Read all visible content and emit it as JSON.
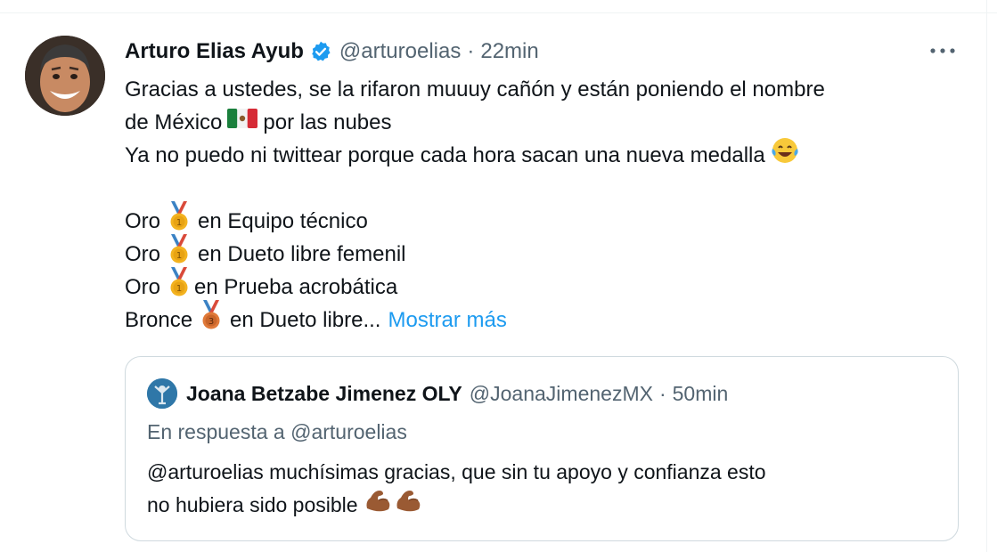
{
  "tweet": {
    "author_name": "Arturo Elias Ayub",
    "handle": "@arturoelias",
    "separator": "·",
    "time": "22min",
    "more_icon": "more-horizontal-icon",
    "lines": {
      "l1": "Gracias a ustedes, se la rifaron muuuy cañón y están poniendo el nombre",
      "l2a": "de México",
      "l2b": "por las nubes",
      "l3": "Ya no puedo ni twittear porque cada hora sacan una nueva medalla",
      "m1a": "Oro",
      "m1b": "en Equipo técnico",
      "m2a": "Oro",
      "m2b": "en Dueto libre femenil",
      "m3a": "Oro",
      "m3b": "en Prueba acrobática",
      "m4a": "Bronce",
      "m4b": "en Dueto libre...",
      "show_more": "Mostrar más"
    }
  },
  "quote": {
    "author_name": "Joana Betzabe Jimenez OLY",
    "handle": "@JoanaJimenezMX",
    "separator": "·",
    "time": "50min",
    "reply_to": "En respuesta a @arturoelias",
    "text_l1": "@arturoelias muchísimas gracias, que sin tu apoyo y confianza esto",
    "text_l2": "no hubiera sido posible"
  },
  "colors": {
    "text": "#0f1419",
    "muted": "#536471",
    "link": "#1d9bf0",
    "border": "#cfd9de"
  }
}
